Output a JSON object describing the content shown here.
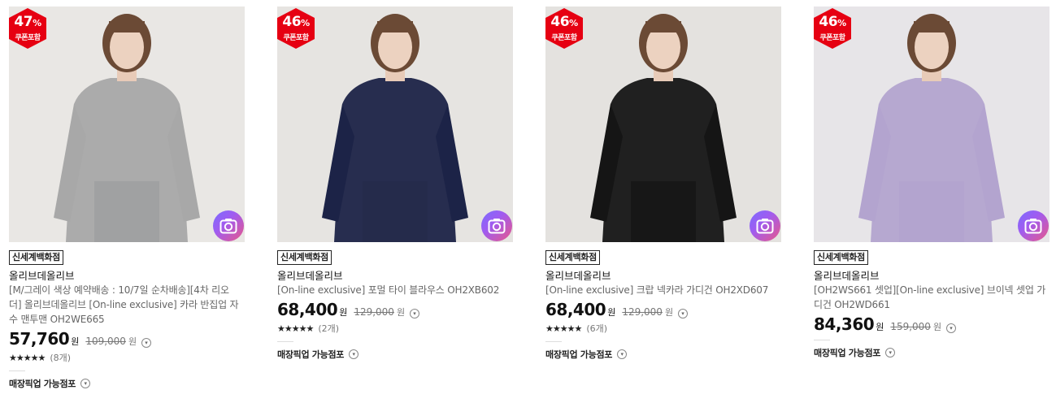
{
  "colors": {
    "badge": "#e60012",
    "camera": "#a05cf0"
  },
  "products": [
    {
      "discount": "47",
      "pct_sign": "%",
      "coupon": "쿠폰포함",
      "store": "신세계백화점",
      "brand": "올리브데올리브",
      "name_lines": [
        "[M/그레이 색상 예약배송 : 10/7일 순차배송][4차 리오",
        "더] 올리브데올리브 [On-line exclusive] 카라 반집업 자",
        "수 맨투맨 OH2WE665"
      ],
      "price": "57,760",
      "won": "원",
      "original_price": "109,000",
      "original_won": "원",
      "rating_stars": "★★★★★",
      "rating": 5,
      "review_count": "(8개)",
      "pickup": "매장픽업 가능점포",
      "photo_bg": "#e9e7e4",
      "cloth": "#a8a8a8",
      "bottom": "#1e2638"
    },
    {
      "discount": "46",
      "pct_sign": "%",
      "coupon": "쿠폰포함",
      "store": "신세계백화점",
      "brand": "올리브데올리브",
      "name_lines": [
        "[On-line exclusive] 포멀 타이 블라우스 OH2XB602"
      ],
      "price": "68,400",
      "won": "원",
      "original_price": "129,000",
      "original_won": "원",
      "rating_stars": "★★★★★",
      "rating": 5,
      "review_count": "(2개)",
      "pickup": "매장픽업 가능점포",
      "photo_bg": "#e6e4e1",
      "cloth": "#1c2347",
      "bottom": "#c9b99a"
    },
    {
      "discount": "46",
      "pct_sign": "%",
      "coupon": "쿠폰포함",
      "store": "신세계백화점",
      "brand": "올리브데올리브",
      "name_lines": [
        "[On-line exclusive] 크랍 넥카라 가디건 OH2XD607"
      ],
      "price": "68,400",
      "won": "원",
      "original_price": "129,000",
      "original_won": "원",
      "rating_stars": "★★★★★",
      "rating": 4.5,
      "review_count": "(6개)",
      "pickup": "매장픽업 가능점포",
      "photo_bg": "#e4e2df",
      "cloth": "#151515",
      "bottom": "#3a3a3a"
    },
    {
      "discount": "46",
      "pct_sign": "%",
      "coupon": "쿠폰포함",
      "store": "신세계백화점",
      "brand": "올리브데올리브",
      "name_lines": [
        "[OH2WS661 셋업][On-line exclusive] 브이넥 셋업 가",
        "디건 OH2WD661"
      ],
      "price": "84,360",
      "won": "원",
      "original_price": "159,000",
      "original_won": "원",
      "rating_stars": "",
      "review_count": "",
      "pickup": "매장픽업 가능점포",
      "photo_bg": "#e7e5e8",
      "cloth": "#b3a4cf",
      "bottom": "#b3a4cf"
    }
  ]
}
